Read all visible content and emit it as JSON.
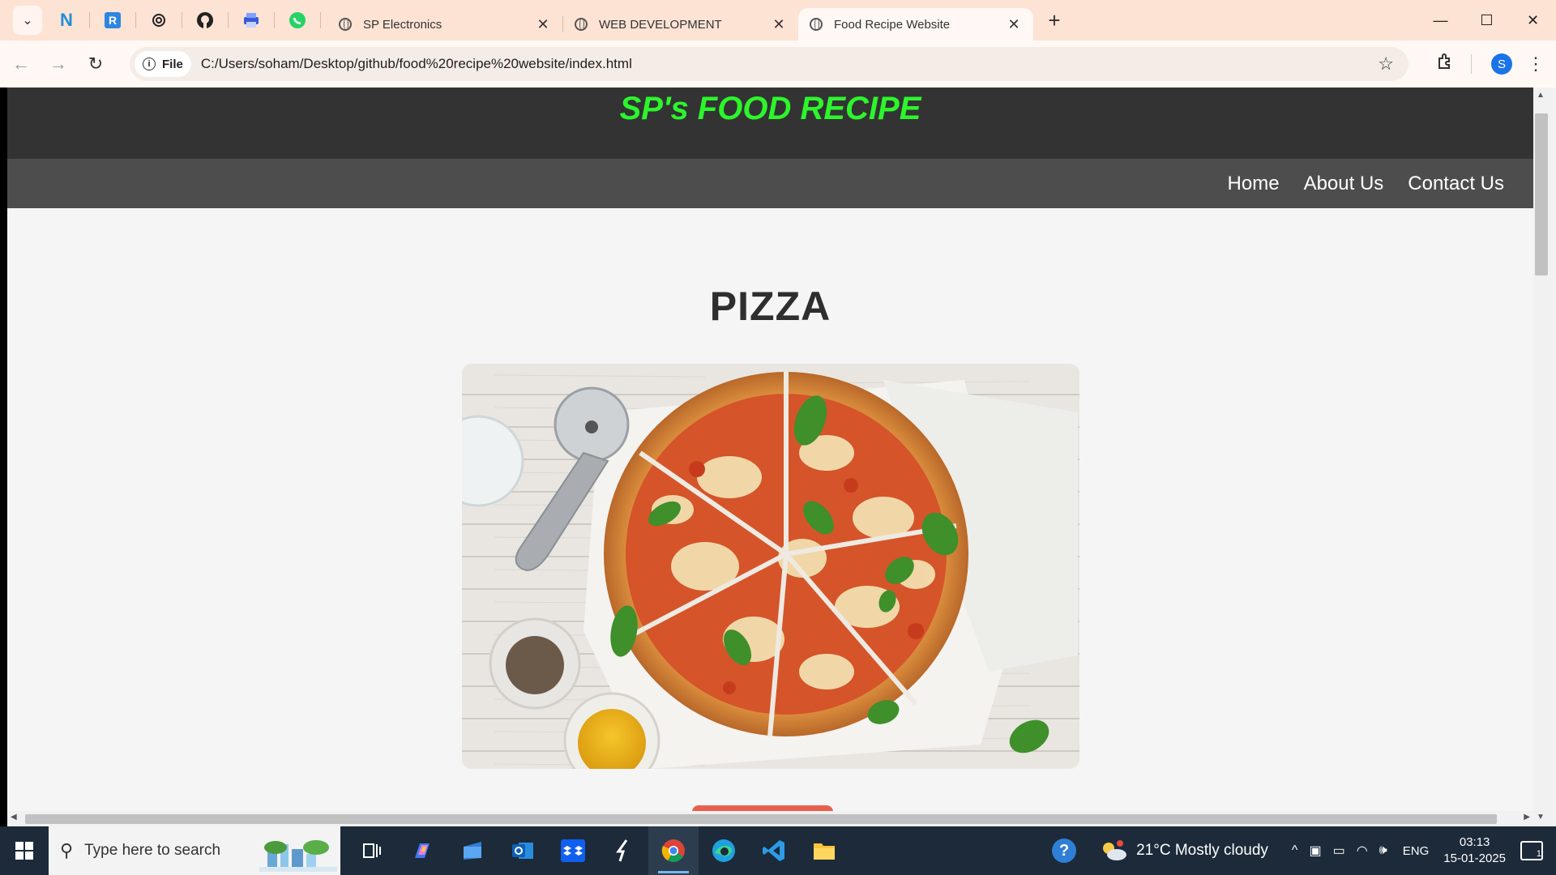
{
  "browser": {
    "tabs": [
      {
        "title": "SP Electronics",
        "active": false
      },
      {
        "title": "WEB DEVELOPMENT",
        "active": false
      },
      {
        "title": "Food Recipe Website",
        "active": true
      }
    ],
    "pinned_icons": [
      "notion-icon",
      "r-app-icon",
      "chatgpt-icon",
      "github-icon",
      "printer-app-icon",
      "whatsapp-icon"
    ],
    "address_chip": "File",
    "url": "C:/Users/soham/Desktop/github/food%20recipe%20website/index.html",
    "profile_initial": "S"
  },
  "site": {
    "title": "SP's FOOD RECIPE",
    "title_color": "#2cf52c",
    "nav": [
      "Home",
      "About Us",
      "Contact Us"
    ],
    "recipe_title": "PIZZA",
    "accent": "#e8604d"
  },
  "taskbar": {
    "search_placeholder": "Type here to search",
    "weather": "21°C  Mostly cloudy",
    "language": "ENG",
    "time": "03:13",
    "date": "15-01-2025",
    "notification_count": "1"
  }
}
